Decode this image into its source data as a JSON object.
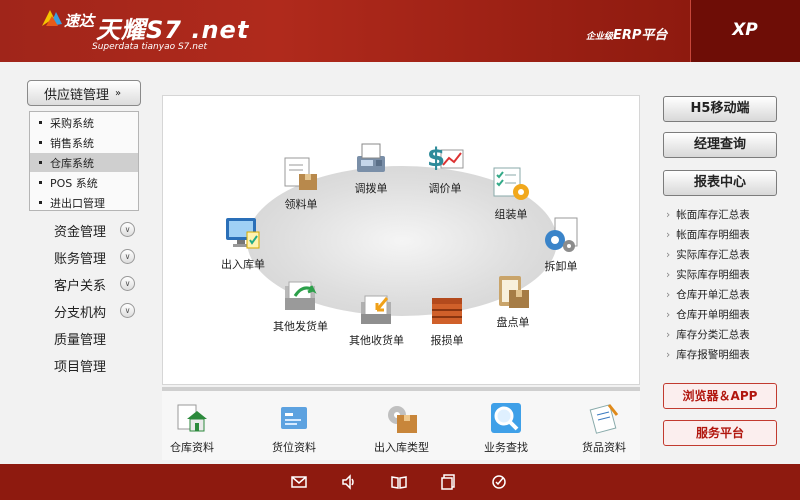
{
  "header": {
    "logo_cn": "速达",
    "logo_main": "天耀S7 .net",
    "logo_sub": "Superdata tianyao S7.net",
    "erp_small": "企业级",
    "erp_label": "ERP平台",
    "edition": "XP"
  },
  "sidebar": {
    "main_menu": "供应链管理",
    "sub_items": [
      {
        "label": "采购系统"
      },
      {
        "label": "销售系统"
      },
      {
        "label": "仓库系统"
      },
      {
        "label": "POS 系统"
      },
      {
        "label": "进出口管理"
      }
    ],
    "menu": [
      {
        "label": "资金管理"
      },
      {
        "label": "账务管理"
      },
      {
        "label": "客户关系"
      },
      {
        "label": "分支机构"
      },
      {
        "label": "质量管理"
      },
      {
        "label": "项目管理"
      }
    ]
  },
  "flow": {
    "items": [
      {
        "label": "调拨单"
      },
      {
        "label": "调价单"
      },
      {
        "label": "领料单"
      },
      {
        "label": "组装单"
      },
      {
        "label": "出入库单"
      },
      {
        "label": "拆卸单"
      },
      {
        "label": "其他发货单"
      },
      {
        "label": "盘点单"
      },
      {
        "label": "其他收货单"
      },
      {
        "label": "报损单"
      }
    ]
  },
  "base": {
    "items": [
      {
        "label": "仓库资料"
      },
      {
        "label": "货位资料"
      },
      {
        "label": "出入库类型"
      },
      {
        "label": "业务查找"
      },
      {
        "label": "货品资料"
      }
    ]
  },
  "right": {
    "buttons": [
      {
        "label": "H5移动端"
      },
      {
        "label": "经理查询"
      },
      {
        "label": "报表中心"
      }
    ],
    "reports": [
      {
        "label": "帐面库存汇总表"
      },
      {
        "label": "帐面库存明细表"
      },
      {
        "label": "实际库存汇总表"
      },
      {
        "label": "实际库存明细表"
      },
      {
        "label": "仓库开单汇总表"
      },
      {
        "label": "仓库开单明细表"
      },
      {
        "label": "库存分类汇总表"
      },
      {
        "label": "库存报警明细表"
      }
    ],
    "red_buttons": [
      {
        "label": "浏览器＆APP"
      },
      {
        "label": "服务平台"
      }
    ]
  },
  "colors": {
    "brand": "#8e1a0f",
    "accent_red": "#b1160e"
  }
}
